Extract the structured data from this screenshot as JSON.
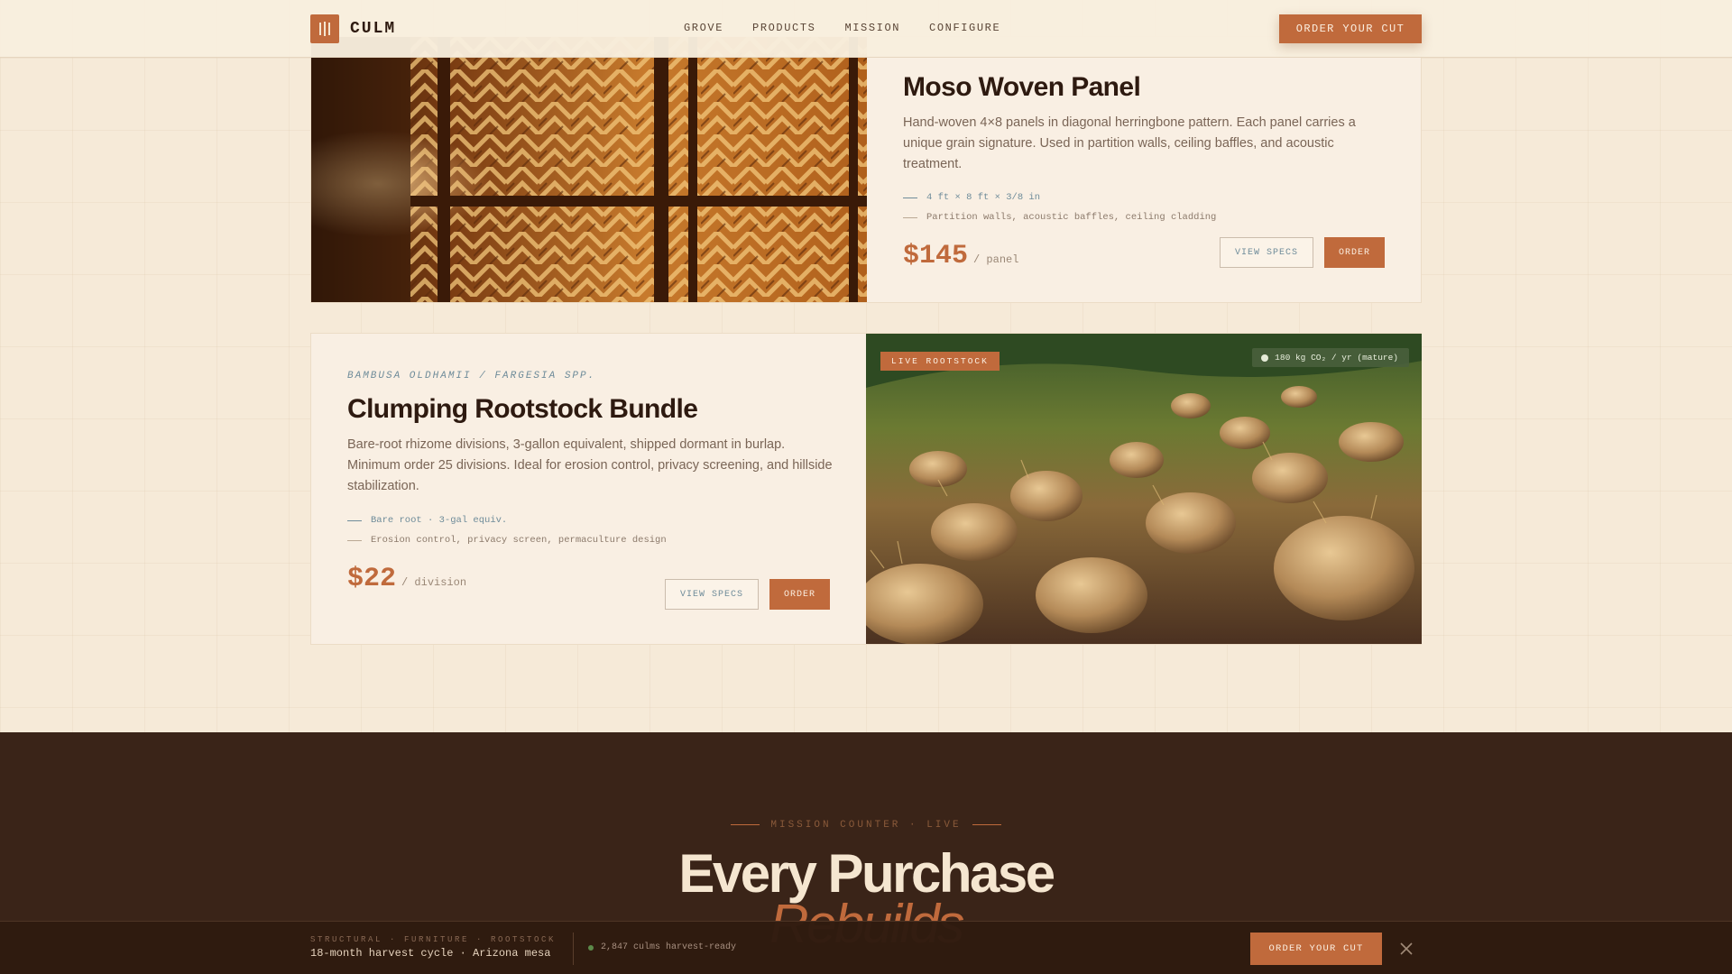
{
  "header": {
    "brand": "CULM",
    "nav": [
      "GROVE",
      "PRODUCTS",
      "MISSION",
      "CONFIGURE"
    ],
    "cta": "ORDER YOUR CUT"
  },
  "products": [
    {
      "title": "Moso Woven Panel",
      "description": "Hand-woven 4×8 panels in diagonal herringbone pattern. Each panel carries a unique grain signature. Used in partition walls, ceiling baffles, and acoustic treatment.",
      "specs": [
        "4 ft × 8 ft × 3/8 in",
        "Partition walls, acoustic baffles, ceiling cladding"
      ],
      "price": "$145",
      "unit": "/ panel",
      "view_specs": "VIEW SPECS",
      "order": "ORDER"
    },
    {
      "latin": "BAMBUSA OLDHAMII / FARGESIA SPP.",
      "title": "Clumping Rootstock Bundle",
      "description": "Bare-root rhizome divisions, 3-gallon equivalent, shipped dormant in burlap. Minimum order 25 divisions. Ideal for erosion control, privacy screening, and hillside stabilization.",
      "specs": [
        "Bare root · 3-gal equiv.",
        "Erosion control, privacy screen, permaculture design"
      ],
      "price": "$22",
      "unit": "/ division",
      "view_specs": "VIEW SPECS",
      "order": "ORDER",
      "badge": "LIVE ROOTSTOCK",
      "co2": "180 kg CO₂ / yr (mature)"
    }
  ],
  "mission": {
    "eyebrow": "MISSION COUNTER · LIVE",
    "title": "Every Purchase",
    "subtitle": "Rebuilds"
  },
  "bottom_bar": {
    "categories": "STRUCTURAL · FURNITURE · ROOTSTOCK",
    "cycle": "18-month harvest cycle · Arizona mesa",
    "status": "2,847 culms harvest-ready",
    "cta": "ORDER YOUR CUT"
  },
  "colors": {
    "accent": "#c06a3c",
    "dark": "#3a2418",
    "background": "#f6ead8",
    "muted_blue": "#6f8c9a"
  }
}
